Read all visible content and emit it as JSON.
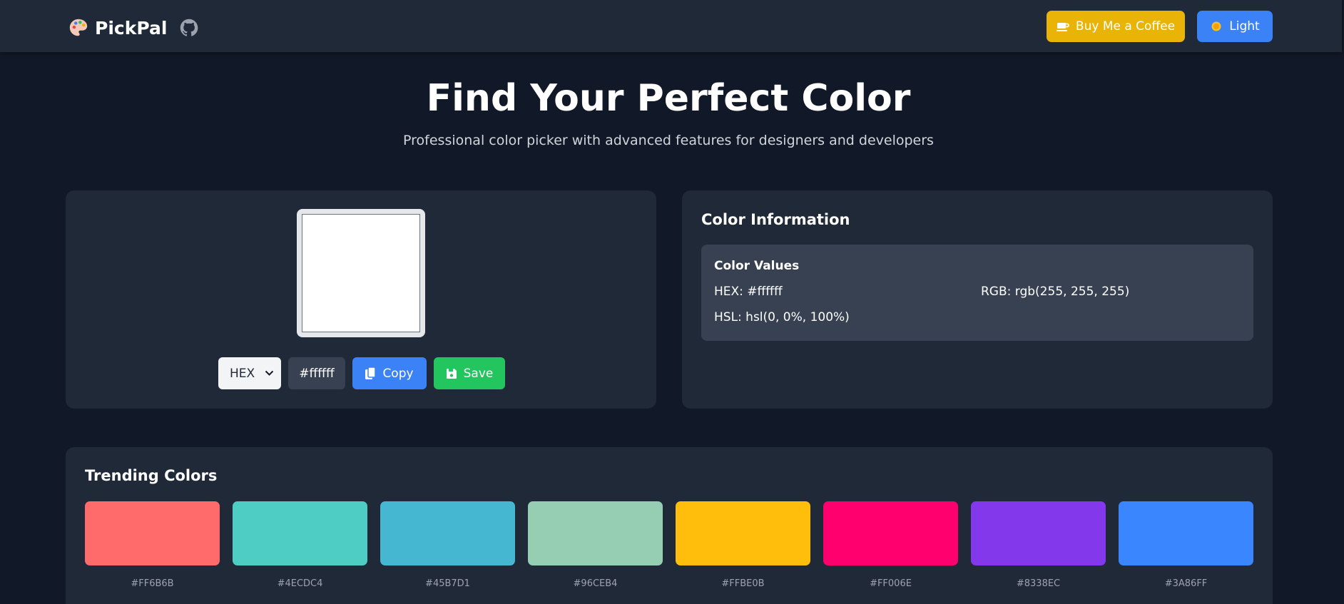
{
  "header": {
    "brand_name": "PickPal",
    "coffee_label": "Buy Me a Coffee",
    "theme_label": "Light",
    "icons": [
      "palette-icon",
      "github-icon",
      "coffee-icon",
      "sun-icon"
    ]
  },
  "hero": {
    "title": "Find Your Perfect Color",
    "subtitle": "Professional color picker with advanced features for designers and developers"
  },
  "picker": {
    "swatch_color": "#ffffff",
    "format_selected": "HEX",
    "value": "#ffffff",
    "copy_label": "Copy",
    "save_label": "Save"
  },
  "info": {
    "title": "Color Information",
    "values_title": "Color Values",
    "hex": "HEX: #ffffff",
    "rgb": "RGB: rgb(255, 255, 255)",
    "hsl": "HSL: hsl(0, 0%, 100%)"
  },
  "trending": {
    "title": "Trending Colors",
    "colors": [
      {
        "hex": "#FF6B6B",
        "label": "#FF6B6B"
      },
      {
        "hex": "#4ECDC4",
        "label": "#4ECDC4"
      },
      {
        "hex": "#45B7D1",
        "label": "#45B7D1"
      },
      {
        "hex": "#96CEB4",
        "label": "#96CEB4"
      },
      {
        "hex": "#FFBE0B",
        "label": "#FFBE0B"
      },
      {
        "hex": "#FF006E",
        "label": "#FF006E"
      },
      {
        "hex": "#8338EC",
        "label": "#8338EC"
      },
      {
        "hex": "#3A86FF",
        "label": "#3A86FF"
      }
    ]
  },
  "colors": {
    "background": "#111827",
    "card": "#1f2937",
    "coffee_button": "#eab308",
    "primary_button": "#3b82f6",
    "save_button": "#22c55e"
  }
}
